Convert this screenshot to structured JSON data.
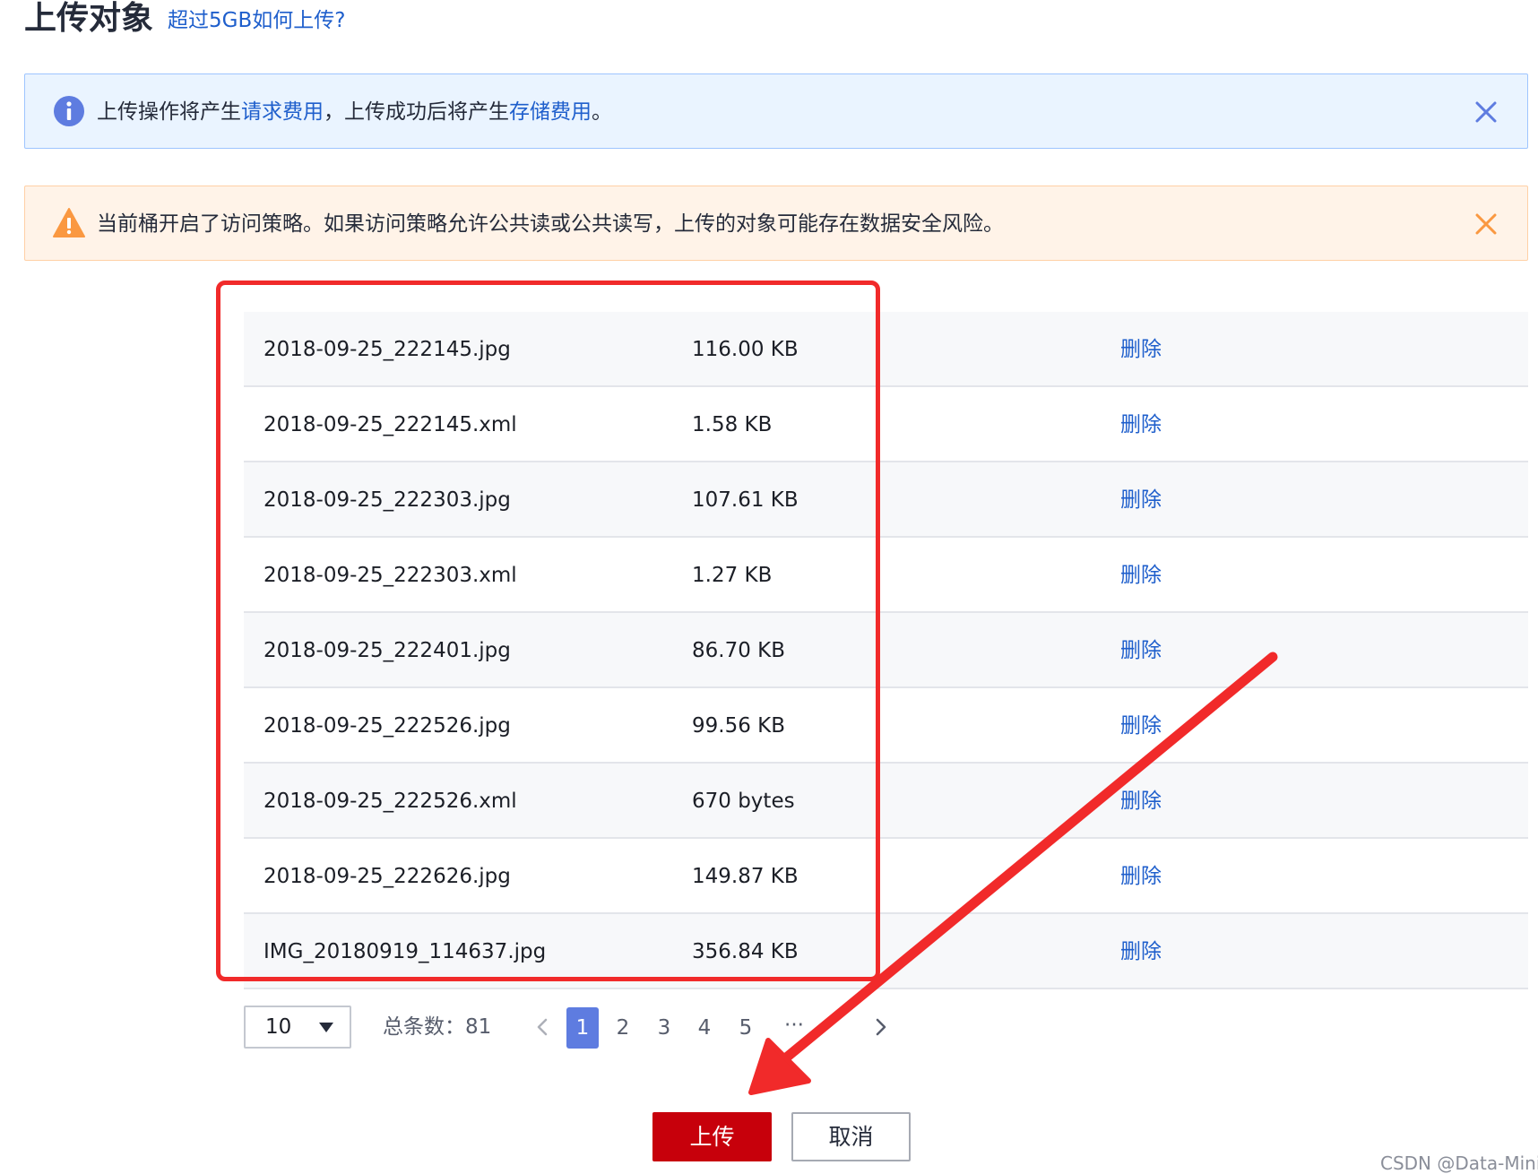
{
  "header": {
    "title": "上传对象",
    "help_link": "超过5GB如何上传?"
  },
  "alerts": {
    "info": {
      "icon": "info-icon",
      "text_pre": "上传操作将产生",
      "link1": "请求费用",
      "text_mid": "，上传成功后将产生",
      "link2": "存储费用",
      "text_post": "。",
      "color": "#5e7ce0"
    },
    "warning": {
      "icon": "warning-icon",
      "text": "当前桶开启了访问策略。如果访问策略允许公共读或公共读写，上传的对象可能存在数据安全风险。",
      "color": "#fa9841"
    }
  },
  "files": [
    {
      "name": "2018-09-25_222145.jpg",
      "size": "116.00 KB",
      "action": "删除"
    },
    {
      "name": "2018-09-25_222145.xml",
      "size": "1.58 KB",
      "action": "删除"
    },
    {
      "name": "2018-09-25_222303.jpg",
      "size": "107.61 KB",
      "action": "删除"
    },
    {
      "name": "2018-09-25_222303.xml",
      "size": "1.27 KB",
      "action": "删除"
    },
    {
      "name": "2018-09-25_222401.jpg",
      "size": "86.70 KB",
      "action": "删除"
    },
    {
      "name": "2018-09-25_222526.jpg",
      "size": "99.56 KB",
      "action": "删除"
    },
    {
      "name": "2018-09-25_222526.xml",
      "size": "670 bytes",
      "action": "删除"
    },
    {
      "name": "2018-09-25_222626.jpg",
      "size": "149.87 KB",
      "action": "删除"
    },
    {
      "name": "IMG_20180919_114637.jpg",
      "size": "356.84 KB",
      "action": "删除"
    }
  ],
  "pagination": {
    "page_size": "10",
    "total_label": "总条数：81",
    "pages": [
      "1",
      "2",
      "3",
      "4",
      "5"
    ],
    "current_page": "1",
    "ellipsis": "···"
  },
  "buttons": {
    "upload": "上传",
    "cancel": "取消"
  },
  "watermark": "CSDN @Data-Mining",
  "colors": {
    "brand_red": "#c7000b",
    "link_blue": "#1f5fcc",
    "annotation_red": "#f12a2a",
    "active_page": "#5e7ce0"
  }
}
